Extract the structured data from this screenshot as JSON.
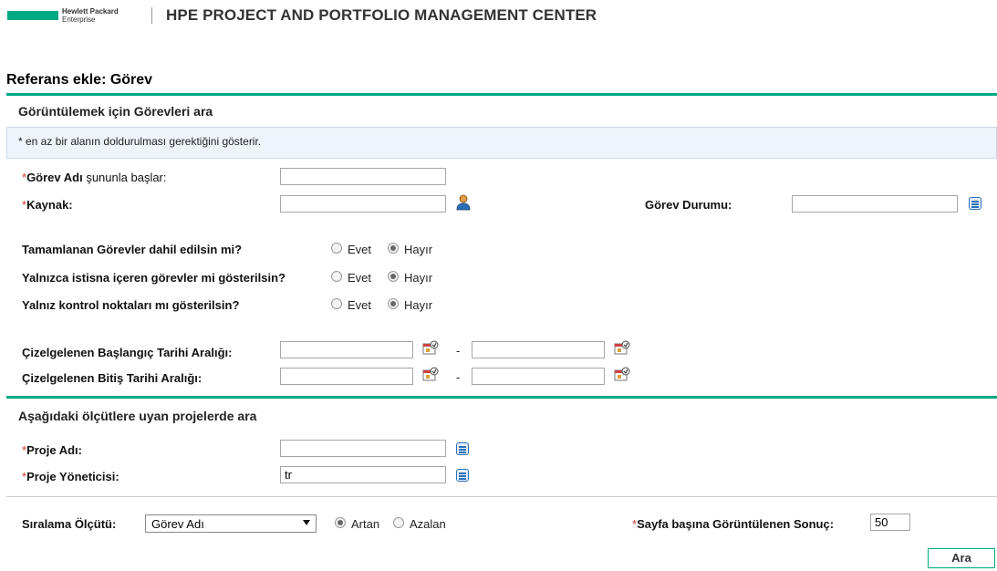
{
  "header": {
    "brand_line1": "Hewlett Packard",
    "brand_line2": "Enterprise",
    "app_title": "HPE PROJECT AND PORTFOLIO MANAGEMENT CENTER"
  },
  "page_title": "Referans ekle: Görev",
  "search_section": {
    "title": "Görüntülemek için Görevleri ara",
    "info": "* en az bir alanın doldurulması gerektiğini gösterir.",
    "task_name_label_bold": "Görev Adı",
    "task_name_label_rest": " şununla başlar:",
    "task_name_value": "",
    "resource_label": "Kaynak:",
    "resource_value": "",
    "task_status_label": "Görev Durumu:",
    "task_status_value": "",
    "questions": [
      {
        "label": "Tamamlanan Görevler dahil edilsin mi?",
        "yes": "Evet",
        "no": "Hayır",
        "selected": "no"
      },
      {
        "label": "Yalnızca istisna içeren görevler mi gösterilsin?",
        "yes": "Evet",
        "no": "Hayır",
        "selected": "no"
      },
      {
        "label": "Yalnız kontrol noktaları mı gösterilsin?",
        "yes": "Evet",
        "no": "Hayır",
        "selected": "no"
      }
    ],
    "start_range_label": "Çizelgelenen Başlangıç Tarihi Aralığı:",
    "end_range_label": "Çizelgelenen Bitiş Tarihi Aralığı:",
    "range_separator": "-"
  },
  "project_section": {
    "title": "Aşağıdaki ölçütlere uyan projelerde ara",
    "project_name_label": "Proje Adı:",
    "project_name_value": "",
    "project_manager_label": "Proje Yöneticisi:",
    "project_manager_value": "tr"
  },
  "footer": {
    "sort_label": "Sıralama Ölçütü:",
    "sort_value": "Görev Adı",
    "asc_label": "Artan",
    "desc_label": "Azalan",
    "sort_order": "asc",
    "per_page_label": "Sayfa başına Görüntülenen Sonuç:",
    "per_page_value": "50",
    "search_button": "Ara"
  },
  "required_marker": "*",
  "colors": {
    "accent": "#01a982",
    "icon_blue": "#2a6fb8",
    "info_bg": "#eef4fa"
  }
}
